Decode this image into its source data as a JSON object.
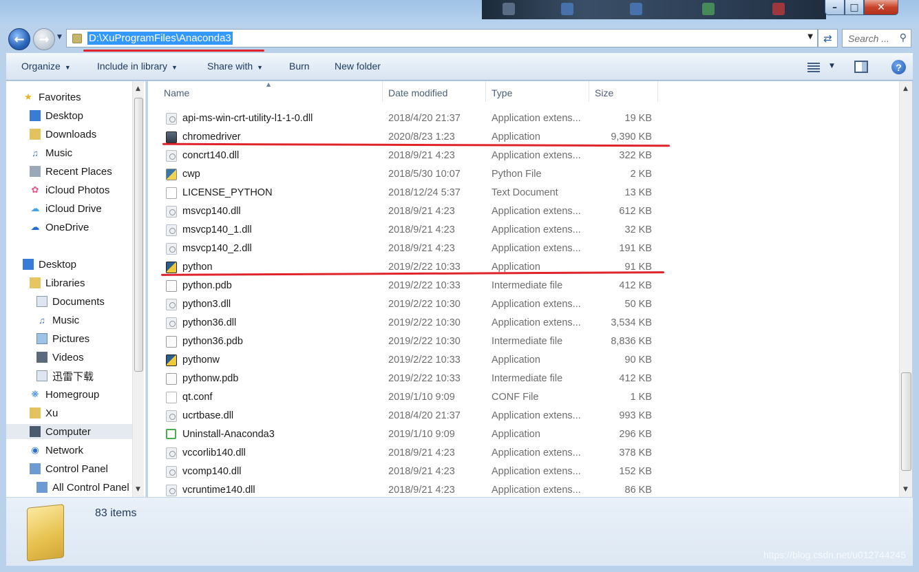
{
  "address": {
    "path": "D:\\XuProgramFiles\\Anaconda3"
  },
  "search": {
    "placeholder": "Search ..."
  },
  "toolbar": {
    "organize": "Organize",
    "include_in_library": "Include in library",
    "share_with": "Share with",
    "burn": "Burn",
    "new_folder": "New folder"
  },
  "nav": {
    "favorites": "Favorites",
    "desktop": "Desktop",
    "downloads": "Downloads",
    "music": "Music",
    "recent_places": "Recent Places",
    "icloud_photos": "iCloud Photos",
    "icloud_drive": "iCloud Drive",
    "onedrive": "OneDrive",
    "desktop2": "Desktop",
    "libraries": "Libraries",
    "documents": "Documents",
    "music2": "Music",
    "pictures": "Pictures",
    "videos": "Videos",
    "xunlei": "迅雷下载",
    "homegroup": "Homegroup",
    "xu": "Xu",
    "computer": "Computer",
    "network": "Network",
    "control_panel": "Control Panel",
    "all_control_panel": "All Control Panel"
  },
  "columns": {
    "name": "Name",
    "date_modified": "Date modified",
    "type": "Type",
    "size": "Size"
  },
  "files": [
    {
      "name": "api-ms-win-crt-utility-l1-1-0.dll",
      "date": "2018/4/20 21:37",
      "type": "Application extens...",
      "size": "19 KB",
      "icon": "dll"
    },
    {
      "name": "chromedriver",
      "date": "2020/8/23 1:23",
      "type": "Application",
      "size": "9,390 KB",
      "icon": "app"
    },
    {
      "name": "concrt140.dll",
      "date": "2018/9/21 4:23",
      "type": "Application extens...",
      "size": "322 KB",
      "icon": "dll"
    },
    {
      "name": "cwp",
      "date": "2018/5/30 10:07",
      "type": "Python File",
      "size": "2 KB",
      "icon": "py"
    },
    {
      "name": "LICENSE_PYTHON",
      "date": "2018/12/24 5:37",
      "type": "Text Document",
      "size": "13 KB",
      "icon": "doc"
    },
    {
      "name": "msvcp140.dll",
      "date": "2018/9/21 4:23",
      "type": "Application extens...",
      "size": "612 KB",
      "icon": "dll"
    },
    {
      "name": "msvcp140_1.dll",
      "date": "2018/9/21 4:23",
      "type": "Application extens...",
      "size": "32 KB",
      "icon": "dll"
    },
    {
      "name": "msvcp140_2.dll",
      "date": "2018/9/21 4:23",
      "type": "Application extens...",
      "size": "191 KB",
      "icon": "dll"
    },
    {
      "name": "python",
      "date": "2019/2/22 10:33",
      "type": "Application",
      "size": "91 KB",
      "icon": "pyexe"
    },
    {
      "name": "python.pdb",
      "date": "2019/2/22 10:33",
      "type": "Intermediate file",
      "size": "412 KB",
      "icon": "pdb"
    },
    {
      "name": "python3.dll",
      "date": "2019/2/22 10:30",
      "type": "Application extens...",
      "size": "50 KB",
      "icon": "dll"
    },
    {
      "name": "python36.dll",
      "date": "2019/2/22 10:30",
      "type": "Application extens...",
      "size": "3,534 KB",
      "icon": "dll"
    },
    {
      "name": "python36.pdb",
      "date": "2019/2/22 10:30",
      "type": "Intermediate file",
      "size": "8,836 KB",
      "icon": "pdb"
    },
    {
      "name": "pythonw",
      "date": "2019/2/22 10:33",
      "type": "Application",
      "size": "90 KB",
      "icon": "pyexe"
    },
    {
      "name": "pythonw.pdb",
      "date": "2019/2/22 10:33",
      "type": "Intermediate file",
      "size": "412 KB",
      "icon": "pdb"
    },
    {
      "name": "qt.conf",
      "date": "2019/1/10 9:09",
      "type": "CONF File",
      "size": "1 KB",
      "icon": "conf"
    },
    {
      "name": "ucrtbase.dll",
      "date": "2018/4/20 21:37",
      "type": "Application extens...",
      "size": "993 KB",
      "icon": "dll"
    },
    {
      "name": "Uninstall-Anaconda3",
      "date": "2019/1/10 9:09",
      "type": "Application",
      "size": "296 KB",
      "icon": "uninst"
    },
    {
      "name": "vccorlib140.dll",
      "date": "2018/9/21 4:23",
      "type": "Application extens...",
      "size": "378 KB",
      "icon": "dll"
    },
    {
      "name": "vcomp140.dll",
      "date": "2018/9/21 4:23",
      "type": "Application extens...",
      "size": "152 KB",
      "icon": "dll"
    },
    {
      "name": "vcruntime140.dll",
      "date": "2018/9/21 4:23",
      "type": "Application extens...",
      "size": "86 KB",
      "icon": "dll"
    }
  ],
  "status": {
    "item_count": "83 items"
  },
  "watermark": "https://blog.csdn.net/u012744245"
}
